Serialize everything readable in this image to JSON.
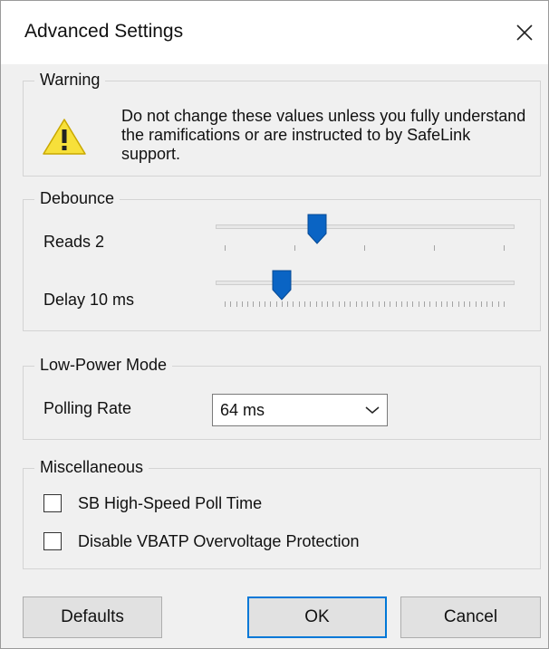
{
  "window": {
    "title": "Advanced Settings",
    "close_icon": "close-icon"
  },
  "warning": {
    "group_title": "Warning",
    "icon": "warning-triangle-icon",
    "text": "Do not change these values unless you fully understand the ramifications or are instructed to by SafeLink support."
  },
  "debounce": {
    "group_title": "Debounce",
    "reads": {
      "label": "Reads 2",
      "fraction": 0.34
    },
    "delay": {
      "label": "Delay 10 ms",
      "fraction": 0.22
    }
  },
  "low_power": {
    "group_title": "Low-Power Mode",
    "polling_label": "Polling Rate",
    "polling_value": "64 ms"
  },
  "misc": {
    "group_title": "Miscellaneous",
    "items": [
      {
        "label": "SB High-Speed Poll Time",
        "checked": false
      },
      {
        "label": "Disable VBATP Overvoltage Protection",
        "checked": false
      }
    ]
  },
  "buttons": {
    "defaults": "Defaults",
    "ok": "OK",
    "cancel": "Cancel"
  },
  "colors": {
    "accent": "#0078d7",
    "slider_thumb": "#0a64c4",
    "warning_fill": "#f7e03a",
    "dialog_bg": "#f0f0f0"
  }
}
